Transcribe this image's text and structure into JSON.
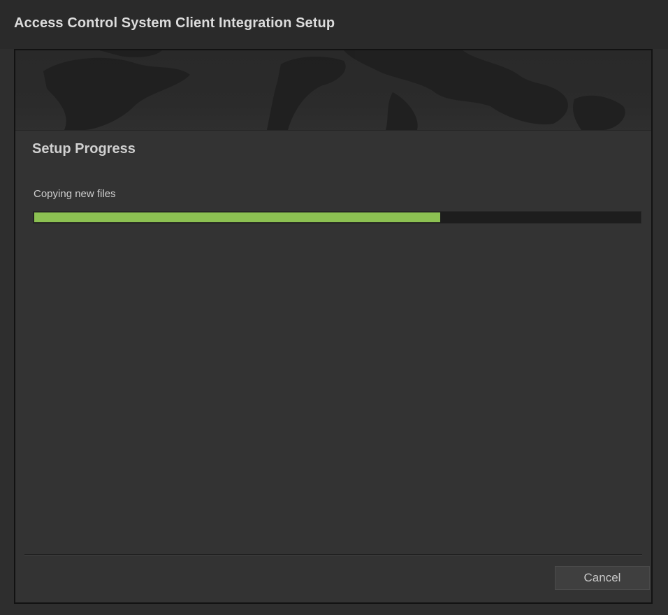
{
  "window": {
    "title": "Access Control System Client Integration Setup"
  },
  "banner": {
    "image": "world-map-background"
  },
  "main": {
    "heading": "Setup Progress",
    "status_text": "Copying new files",
    "progress": {
      "value_percent": 67,
      "fill_color": "#8cc152",
      "track_color": "#1d1d1d"
    }
  },
  "footer": {
    "cancel_label": "Cancel"
  },
  "colors": {
    "background": "#333333",
    "title_bar": "#2a2a2a",
    "accent_green": "#8cc152"
  }
}
